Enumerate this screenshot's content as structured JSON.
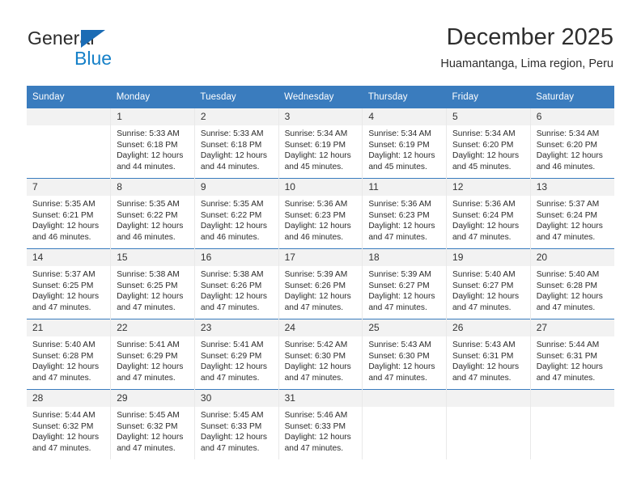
{
  "brand": {
    "name_top": "General",
    "name_bottom": "Blue",
    "accent_color": "#1580c8",
    "triangle_color": "#1b6cb5"
  },
  "header": {
    "title": "December 2025",
    "subtitle": "Huamantanga, Lima region, Peru"
  },
  "calendar": {
    "header_bg": "#3a7cbe",
    "daynum_bg": "#f2f2f2",
    "weekdays": [
      "Sunday",
      "Monday",
      "Tuesday",
      "Wednesday",
      "Thursday",
      "Friday",
      "Saturday"
    ],
    "weeks": [
      [
        {
          "day": "",
          "sunrise": "",
          "sunset": "",
          "daylight_line1": "",
          "daylight_line2": ""
        },
        {
          "day": "1",
          "sunrise": "Sunrise: 5:33 AM",
          "sunset": "Sunset: 6:18 PM",
          "daylight_line1": "Daylight: 12 hours",
          "daylight_line2": "and 44 minutes."
        },
        {
          "day": "2",
          "sunrise": "Sunrise: 5:33 AM",
          "sunset": "Sunset: 6:18 PM",
          "daylight_line1": "Daylight: 12 hours",
          "daylight_line2": "and 44 minutes."
        },
        {
          "day": "3",
          "sunrise": "Sunrise: 5:34 AM",
          "sunset": "Sunset: 6:19 PM",
          "daylight_line1": "Daylight: 12 hours",
          "daylight_line2": "and 45 minutes."
        },
        {
          "day": "4",
          "sunrise": "Sunrise: 5:34 AM",
          "sunset": "Sunset: 6:19 PM",
          "daylight_line1": "Daylight: 12 hours",
          "daylight_line2": "and 45 minutes."
        },
        {
          "day": "5",
          "sunrise": "Sunrise: 5:34 AM",
          "sunset": "Sunset: 6:20 PM",
          "daylight_line1": "Daylight: 12 hours",
          "daylight_line2": "and 45 minutes."
        },
        {
          "day": "6",
          "sunrise": "Sunrise: 5:34 AM",
          "sunset": "Sunset: 6:20 PM",
          "daylight_line1": "Daylight: 12 hours",
          "daylight_line2": "and 46 minutes."
        }
      ],
      [
        {
          "day": "7",
          "sunrise": "Sunrise: 5:35 AM",
          "sunset": "Sunset: 6:21 PM",
          "daylight_line1": "Daylight: 12 hours",
          "daylight_line2": "and 46 minutes."
        },
        {
          "day": "8",
          "sunrise": "Sunrise: 5:35 AM",
          "sunset": "Sunset: 6:22 PM",
          "daylight_line1": "Daylight: 12 hours",
          "daylight_line2": "and 46 minutes."
        },
        {
          "day": "9",
          "sunrise": "Sunrise: 5:35 AM",
          "sunset": "Sunset: 6:22 PM",
          "daylight_line1": "Daylight: 12 hours",
          "daylight_line2": "and 46 minutes."
        },
        {
          "day": "10",
          "sunrise": "Sunrise: 5:36 AM",
          "sunset": "Sunset: 6:23 PM",
          "daylight_line1": "Daylight: 12 hours",
          "daylight_line2": "and 46 minutes."
        },
        {
          "day": "11",
          "sunrise": "Sunrise: 5:36 AM",
          "sunset": "Sunset: 6:23 PM",
          "daylight_line1": "Daylight: 12 hours",
          "daylight_line2": "and 47 minutes."
        },
        {
          "day": "12",
          "sunrise": "Sunrise: 5:36 AM",
          "sunset": "Sunset: 6:24 PM",
          "daylight_line1": "Daylight: 12 hours",
          "daylight_line2": "and 47 minutes."
        },
        {
          "day": "13",
          "sunrise": "Sunrise: 5:37 AM",
          "sunset": "Sunset: 6:24 PM",
          "daylight_line1": "Daylight: 12 hours",
          "daylight_line2": "and 47 minutes."
        }
      ],
      [
        {
          "day": "14",
          "sunrise": "Sunrise: 5:37 AM",
          "sunset": "Sunset: 6:25 PM",
          "daylight_line1": "Daylight: 12 hours",
          "daylight_line2": "and 47 minutes."
        },
        {
          "day": "15",
          "sunrise": "Sunrise: 5:38 AM",
          "sunset": "Sunset: 6:25 PM",
          "daylight_line1": "Daylight: 12 hours",
          "daylight_line2": "and 47 minutes."
        },
        {
          "day": "16",
          "sunrise": "Sunrise: 5:38 AM",
          "sunset": "Sunset: 6:26 PM",
          "daylight_line1": "Daylight: 12 hours",
          "daylight_line2": "and 47 minutes."
        },
        {
          "day": "17",
          "sunrise": "Sunrise: 5:39 AM",
          "sunset": "Sunset: 6:26 PM",
          "daylight_line1": "Daylight: 12 hours",
          "daylight_line2": "and 47 minutes."
        },
        {
          "day": "18",
          "sunrise": "Sunrise: 5:39 AM",
          "sunset": "Sunset: 6:27 PM",
          "daylight_line1": "Daylight: 12 hours",
          "daylight_line2": "and 47 minutes."
        },
        {
          "day": "19",
          "sunrise": "Sunrise: 5:40 AM",
          "sunset": "Sunset: 6:27 PM",
          "daylight_line1": "Daylight: 12 hours",
          "daylight_line2": "and 47 minutes."
        },
        {
          "day": "20",
          "sunrise": "Sunrise: 5:40 AM",
          "sunset": "Sunset: 6:28 PM",
          "daylight_line1": "Daylight: 12 hours",
          "daylight_line2": "and 47 minutes."
        }
      ],
      [
        {
          "day": "21",
          "sunrise": "Sunrise: 5:40 AM",
          "sunset": "Sunset: 6:28 PM",
          "daylight_line1": "Daylight: 12 hours",
          "daylight_line2": "and 47 minutes."
        },
        {
          "day": "22",
          "sunrise": "Sunrise: 5:41 AM",
          "sunset": "Sunset: 6:29 PM",
          "daylight_line1": "Daylight: 12 hours",
          "daylight_line2": "and 47 minutes."
        },
        {
          "day": "23",
          "sunrise": "Sunrise: 5:41 AM",
          "sunset": "Sunset: 6:29 PM",
          "daylight_line1": "Daylight: 12 hours",
          "daylight_line2": "and 47 minutes."
        },
        {
          "day": "24",
          "sunrise": "Sunrise: 5:42 AM",
          "sunset": "Sunset: 6:30 PM",
          "daylight_line1": "Daylight: 12 hours",
          "daylight_line2": "and 47 minutes."
        },
        {
          "day": "25",
          "sunrise": "Sunrise: 5:43 AM",
          "sunset": "Sunset: 6:30 PM",
          "daylight_line1": "Daylight: 12 hours",
          "daylight_line2": "and 47 minutes."
        },
        {
          "day": "26",
          "sunrise": "Sunrise: 5:43 AM",
          "sunset": "Sunset: 6:31 PM",
          "daylight_line1": "Daylight: 12 hours",
          "daylight_line2": "and 47 minutes."
        },
        {
          "day": "27",
          "sunrise": "Sunrise: 5:44 AM",
          "sunset": "Sunset: 6:31 PM",
          "daylight_line1": "Daylight: 12 hours",
          "daylight_line2": "and 47 minutes."
        }
      ],
      [
        {
          "day": "28",
          "sunrise": "Sunrise: 5:44 AM",
          "sunset": "Sunset: 6:32 PM",
          "daylight_line1": "Daylight: 12 hours",
          "daylight_line2": "and 47 minutes."
        },
        {
          "day": "29",
          "sunrise": "Sunrise: 5:45 AM",
          "sunset": "Sunset: 6:32 PM",
          "daylight_line1": "Daylight: 12 hours",
          "daylight_line2": "and 47 minutes."
        },
        {
          "day": "30",
          "sunrise": "Sunrise: 5:45 AM",
          "sunset": "Sunset: 6:33 PM",
          "daylight_line1": "Daylight: 12 hours",
          "daylight_line2": "and 47 minutes."
        },
        {
          "day": "31",
          "sunrise": "Sunrise: 5:46 AM",
          "sunset": "Sunset: 6:33 PM",
          "daylight_line1": "Daylight: 12 hours",
          "daylight_line2": "and 47 minutes."
        },
        {
          "day": "",
          "sunrise": "",
          "sunset": "",
          "daylight_line1": "",
          "daylight_line2": ""
        },
        {
          "day": "",
          "sunrise": "",
          "sunset": "",
          "daylight_line1": "",
          "daylight_line2": ""
        },
        {
          "day": "",
          "sunrise": "",
          "sunset": "",
          "daylight_line1": "",
          "daylight_line2": ""
        }
      ]
    ]
  }
}
